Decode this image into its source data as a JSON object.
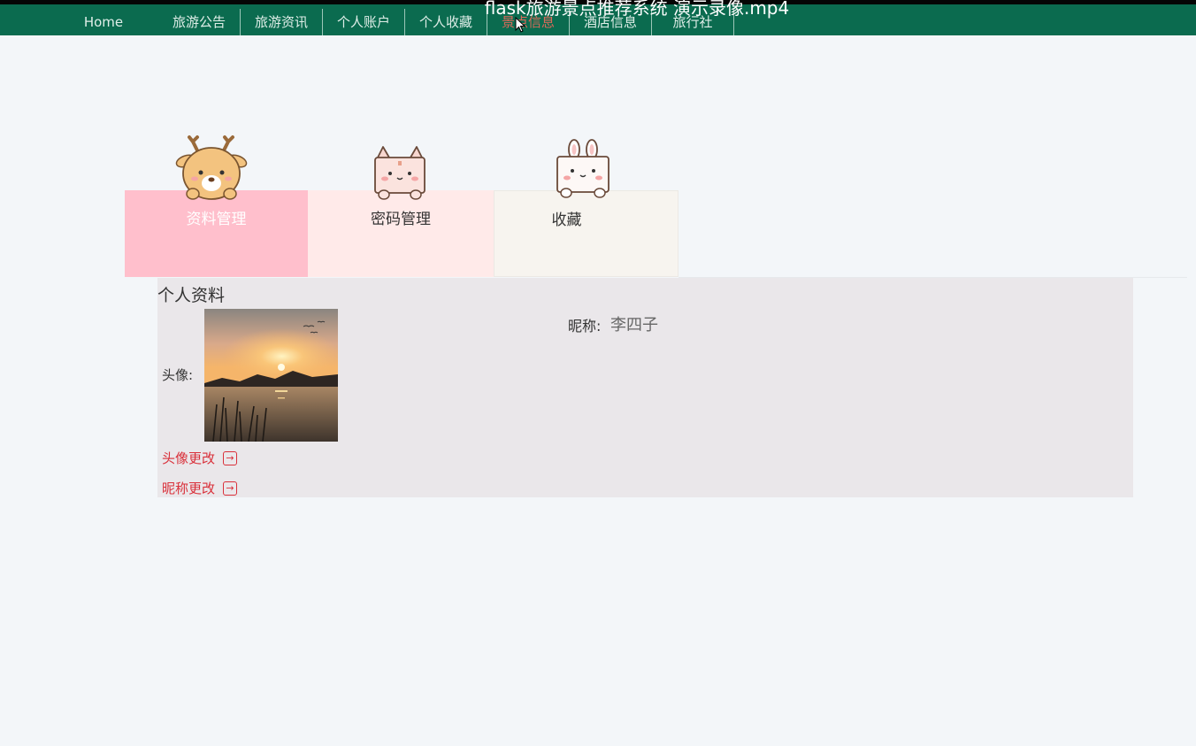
{
  "video_title": "flask旅游景点推荐系统 演示录像.mp4",
  "nav": {
    "items": [
      "Home",
      "旅游公告",
      "旅游资讯",
      "个人账户",
      "个人收藏",
      "景点信息",
      "酒店信息",
      "旅行社"
    ],
    "active_index": 5
  },
  "tabs": [
    {
      "label": "资料管理",
      "icon": "deer-icon",
      "bg": "#ffbfcc",
      "text_color": "#ffffff"
    },
    {
      "label": "密码管理",
      "icon": "cat-icon",
      "bg": "#ffeae9",
      "text_color": "#333333"
    },
    {
      "label": "收藏",
      "icon": "rabbit-icon",
      "bg": "#f7f4ef",
      "text_color": "#333333"
    }
  ],
  "profile": {
    "title": "个人资料",
    "avatar_label": "头像:",
    "avatar_image": "sunset-lake-image",
    "nickname_label": "昵称:",
    "nickname_value": "李四子",
    "actions": [
      "头像更改",
      "昵称更改"
    ]
  },
  "colors": {
    "nav_bg": "#0b6b4f",
    "nav_active": "#d96a5a",
    "action_red": "#d9303a",
    "panel_bg": "#eae7ea"
  }
}
